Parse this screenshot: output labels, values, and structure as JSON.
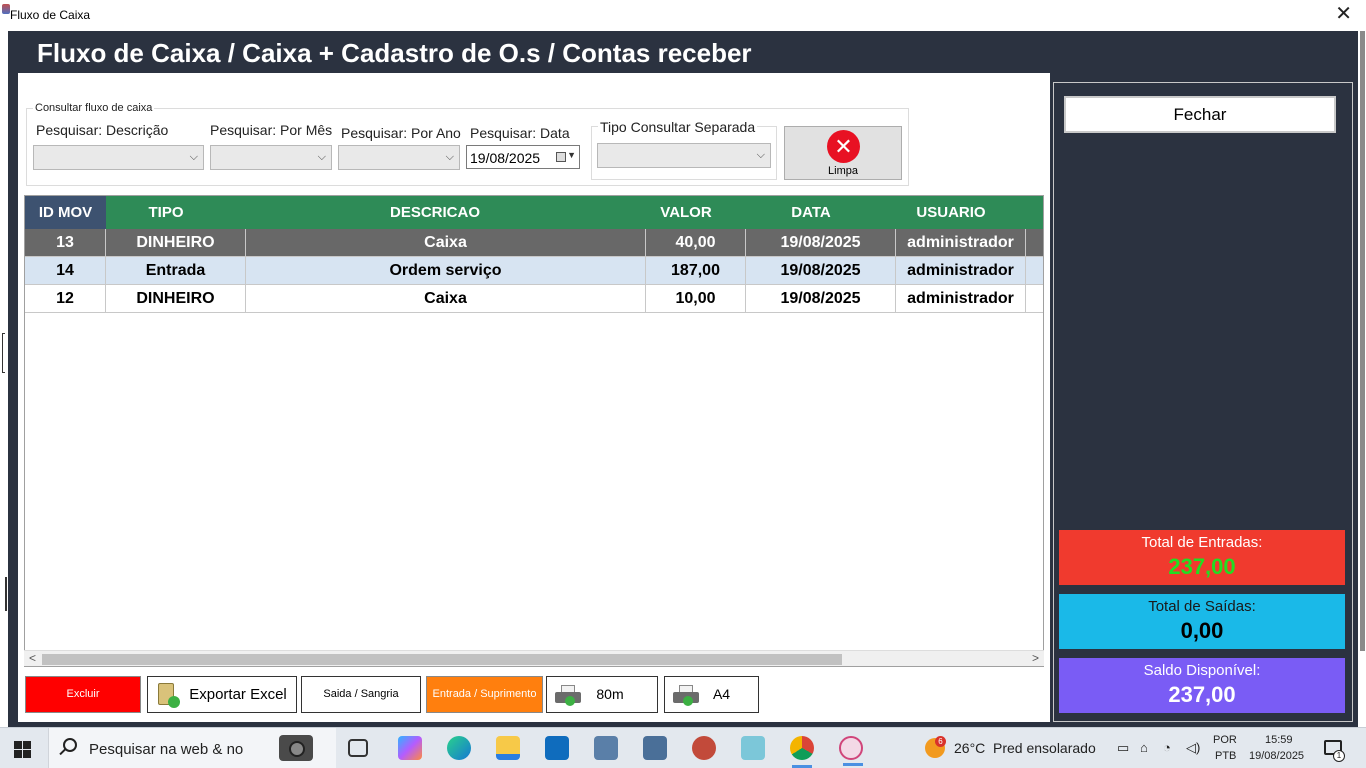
{
  "window": {
    "title": "Fluxo de Caixa",
    "close_glyph": "✕"
  },
  "header": {
    "title": "Fluxo de Caixa / Caixa + Cadastro de O.s / Contas receber"
  },
  "filters": {
    "group_label": "Consultar fluxo de caixa",
    "descricao_label": "Pesquisar: Descrição",
    "descricao_value": "",
    "mes_label": "Pesquisar: Por Mês",
    "mes_value": "",
    "ano_label": "Pesquisar: Por Ano",
    "ano_value": "",
    "data_label": "Pesquisar: Data",
    "data_value": "19/08/2025",
    "tipo_label": "Tipo Consultar Separada",
    "tipo_value": "",
    "limpa_label": "Limpa"
  },
  "grid": {
    "columns": [
      "ID MOV",
      "TIPO",
      "DESCRICAO",
      "VALOR",
      "DATA",
      "USUARIO"
    ],
    "rows": [
      [
        "13",
        "DINHEIRO",
        "Caixa",
        "40,00",
        "19/08/2025",
        "administrador"
      ],
      [
        "14",
        "Entrada",
        "Ordem serviço",
        "187,00",
        "19/08/2025",
        "administrador"
      ],
      [
        "12",
        "DINHEIRO",
        "Caixa",
        "10,00",
        "19/08/2025",
        "administrador"
      ]
    ]
  },
  "actions": {
    "excluir": "Excluir",
    "exportar_excel": "Exportar Excel",
    "saida_sangria": "Saida / Sangria",
    "entrada_suprimento": "Entrada / Suprimento",
    "print_80": "80m",
    "print_a4": "A4"
  },
  "side": {
    "fechar": "Fechar",
    "total_entradas_label": "Total de Entradas:",
    "total_entradas_value": "237,00",
    "total_saidas_label": "Total de Saídas:",
    "total_saidas_value": "0,00",
    "saldo_label": "Saldo Disponível:",
    "saldo_value": "237,00"
  },
  "colors": {
    "grid_header": "#2e8b57",
    "entradas_bg": "#f03a2e",
    "saidas_bg": "#1ab9e8",
    "saldo_bg": "#7a5cf5",
    "excluir_bg": "#ff0000",
    "suprimento_bg": "#ff7f0e"
  },
  "taskbar": {
    "search_placeholder": "Pesquisar na web & no",
    "weather_temp": "26°C",
    "weather_desc": "Pred ensolarado",
    "weather_badge": "6",
    "lang_1": "POR",
    "lang_2": "PTB",
    "time": "15:59",
    "date": "19/08/2025",
    "notif_count": "1",
    "icons": [
      "start-icon",
      "search-icon",
      "camera-icon",
      "task-view-icon",
      "copilot-icon",
      "edge-icon",
      "file-explorer-icon",
      "outlook-icon",
      "scanner-app-icon",
      "network-app-icon",
      "tools-app-icon",
      "notes-app-icon",
      "chrome-icon",
      "app-icon"
    ]
  }
}
